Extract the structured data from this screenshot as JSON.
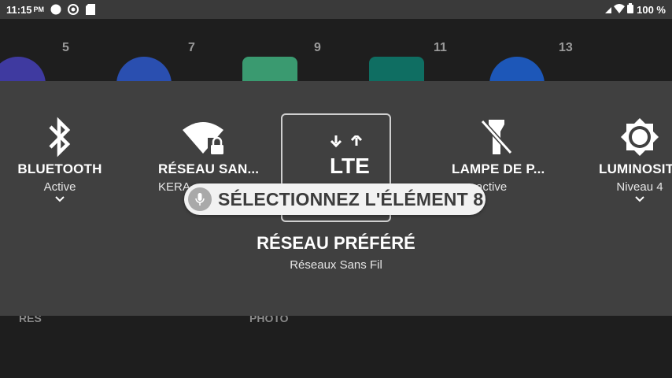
{
  "status_bar": {
    "time": "11:15",
    "ampm": "PM",
    "battery": "100 %",
    "icons": [
      "circle-notification-icon",
      "settings-notification-icon",
      "sd-card-icon",
      "signal-icon",
      "wifi-icon",
      "battery-icon"
    ]
  },
  "background": {
    "numbers": [
      "5",
      "7",
      "9",
      "11",
      "13"
    ],
    "labels": [
      "RES",
      "PHOTO"
    ]
  },
  "quick_settings": {
    "tiles": [
      {
        "title": "BLUETOOTH",
        "subtitle": "Active",
        "icon": "bluetooth-icon"
      },
      {
        "title": "RÉSEAU SAN...",
        "subtitle": "KERA",
        "icon": "wifi-lock-icon"
      },
      {
        "title": "",
        "subtitle": "",
        "icon": "lte-icon"
      },
      {
        "title": "LAMPE DE P...",
        "subtitle": "active",
        "icon": "flashlight-off-icon"
      },
      {
        "title": "LUMINOSIT",
        "subtitle": "Niveau 4",
        "icon": "brightness-icon"
      }
    ],
    "focused_title": "RÉSEAU PRÉFÉRÉ",
    "focused_subtitle": "Réseaux Sans Fil"
  },
  "voice_access": {
    "command": "SÉLECTIONNEZ L'ÉLÉMENT 8",
    "icon": "microphone-icon"
  },
  "colors": {
    "panel": "#404040",
    "status_bar": "#3a3a3a",
    "pill": "#f2f2f2"
  }
}
